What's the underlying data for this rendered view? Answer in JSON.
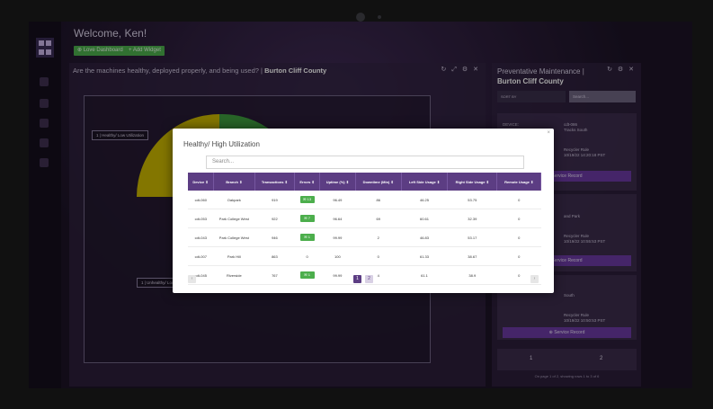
{
  "app": {
    "welcome": "Welcome, Ken!",
    "buttons": {
      "love": "Love Dashboard",
      "add": "Add Widget"
    }
  },
  "main_panel": {
    "question": "Are the machines healthy, deployed properly, and being used? |",
    "location": "Burton Cliff County",
    "chart_labels": {
      "top": "1 | Healthy/ Low Utilization",
      "bottom": "1 | Unhealthy/ Low"
    }
  },
  "pm_panel": {
    "title": "Preventative Maintenance |",
    "location": "Burton Cliff County",
    "sort_by": "SORT BY",
    "search_placeholder": "Search...",
    "cards": [
      {
        "lines": [
          "DEVICE:",
          "BRANCH:"
        ],
        "values": [
          "cdt-086",
          "Tracks South"
        ],
        "info": [
          "Recycler Rule",
          "10/19/22 14:20:18 PST"
        ],
        "button": "Service Record"
      },
      {
        "values": [
          "and Park"
        ],
        "info": [
          "Recycler Rule",
          "10/19/22 10:55:53 PST"
        ],
        "button": "Service Record"
      },
      {
        "values": [
          "South"
        ],
        "info": [
          "Recycler Rule",
          "10/19/22 10:50:53 PST"
        ],
        "button": "Service Record"
      }
    ],
    "pagination": [
      "1",
      "2"
    ],
    "note": "On page 1 of 2, showing rows 1 to 3 of 6"
  },
  "modal": {
    "title": "Healthy/ High Utilization",
    "search_placeholder": "Search...",
    "columns": [
      "Device ⇕",
      "Branch ⇕",
      "Transactions ⇕",
      "Errors ⇕",
      "Uptime (%) ⇕",
      "Downtime (Min) ⇕",
      "Left Side Usage ⇕",
      "Right Side Usage ⇕",
      "Remote Usage ⇕"
    ],
    "rows": [
      [
        "cdt-060",
        "Oakpark",
        "919",
        "13",
        "96.49",
        "86",
        "46.25",
        "53.75",
        "0"
      ],
      [
        "cdt-053",
        "Park College West",
        "922",
        "7",
        "96.64",
        "69",
        "60.61",
        "32.39",
        "0"
      ],
      [
        "cdt-043",
        "Park College West",
        "946",
        "1",
        "99.99",
        "2",
        "46.83",
        "53.17",
        "0"
      ],
      [
        "cdt-007",
        "Park Hill",
        "863",
        "0",
        "100",
        "0",
        "61.33",
        "38.67",
        "0"
      ],
      [
        "cdt-045",
        "Riverside",
        "767",
        "1",
        "99.99",
        "4",
        "61.1",
        "38.9",
        "0"
      ]
    ],
    "pagination": [
      "1",
      "2"
    ]
  },
  "colors": {
    "accent": "#5c3d83",
    "success": "#4cae4c",
    "pie_yellow": "#c9b600",
    "pie_green": "#3e9b3e"
  }
}
